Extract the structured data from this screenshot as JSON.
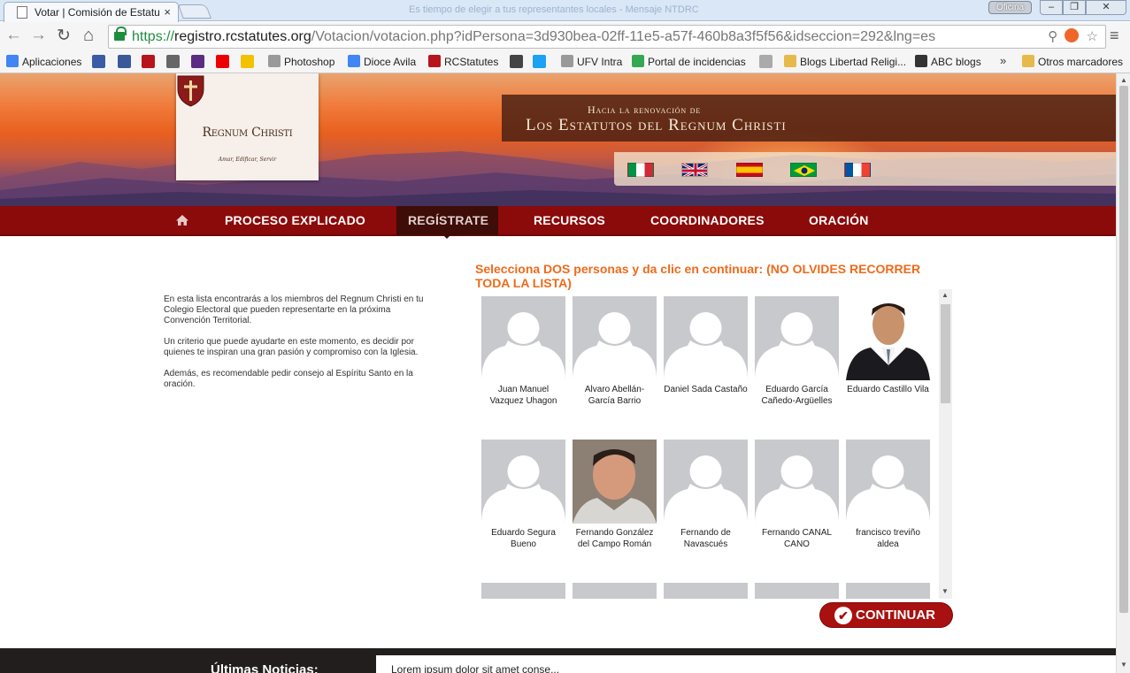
{
  "browser": {
    "tab_title": "Votar | Comisión de Estatu",
    "tab_close": "×",
    "window_title": "Es tiempo de elegir a tus representantes locales - Mensaje NTDRC",
    "profile": "Oficina",
    "window_controls": {
      "minimize": "‒",
      "maximize": "❐",
      "close": "✕"
    },
    "url_scheme": "https://",
    "url_host": "registro.rcstatutes.org",
    "url_path": "/Votacion/votacion.php?idPersona=3d930bea-02ff-11e5-a57f-460b8a3f5f56&idseccion=292&lng=es"
  },
  "bookmarks": {
    "items": [
      {
        "label": "Aplicaciones",
        "icon": "apps-grid-icon",
        "color": "#4285f4"
      },
      {
        "label": "",
        "icon": "bookmark-icon-1",
        "color": "#3b5ba5"
      },
      {
        "label": "",
        "icon": "facebook-icon",
        "color": "#3b5998"
      },
      {
        "label": "",
        "icon": "shield-icon",
        "color": "#b8141b"
      },
      {
        "label": "",
        "icon": "rc-icon",
        "color": "#666666"
      },
      {
        "label": "",
        "icon": "mail-icon",
        "color": "#5a2d82"
      },
      {
        "label": "",
        "icon": "santander-icon",
        "color": "#ec0000"
      },
      {
        "label": "",
        "icon": "b-icon",
        "color": "#f2c200"
      },
      {
        "label": "Photoshop",
        "icon": "page-icon",
        "color": "#999999"
      },
      {
        "label": "Dioce Avila",
        "icon": "google-icon",
        "color": "#4285f4"
      },
      {
        "label": "RCStatutes",
        "icon": "shield-icon",
        "color": "#b8141b"
      },
      {
        "label": "",
        "icon": "ao-icon",
        "color": "#444444"
      },
      {
        "label": "",
        "icon": "twitter-icon",
        "color": "#1da1f2"
      },
      {
        "label": "UFV Intra",
        "icon": "page-icon",
        "color": "#999999"
      },
      {
        "label": "Portal de incidencias",
        "icon": "chrome-icon",
        "color": "#34a853"
      },
      {
        "label": "",
        "icon": "cloud-icon",
        "color": "#aaaaaa"
      },
      {
        "label": "Blogs Libertad Religi...",
        "icon": "folder-icon",
        "color": "#e7b94a"
      },
      {
        "label": "ABC blogs",
        "icon": "abc-icon",
        "color": "#333333"
      }
    ],
    "more": "»",
    "other": "Otros marcadores"
  },
  "header": {
    "logo_title": "Regnum Christi",
    "logo_motto": "Amar, Edificar, Servir",
    "tagline_top": "Hacia la renovación de",
    "tagline_main": "Los Estatutos del Regnum Christi",
    "languages": [
      "Italiano",
      "English",
      "Español",
      "Português",
      "Français"
    ]
  },
  "nav": {
    "items": [
      "PROCESO EXPLICADO",
      "REGÍSTRATE",
      "RECURSOS",
      "COORDINADORES",
      "ORACIÓN"
    ],
    "active": "REGÍSTRATE"
  },
  "intro": [
    "En esta lista encontrarás a los miembros del Regnum Christi en tu Colegio Electoral que pueden representarte en la próxima Convención Territorial.",
    "Un criterio que puede ayudarte en este momento, es decidir por quienes te inspiran una gran pasión y compromiso con la Iglesia.",
    "Además, es recomendable pedir consejo al Espíritu Santo en la oración."
  ],
  "selection": {
    "heading": "Selecciona DOS personas y da clic en continuar: (NO OLVIDES RECORRER TODA LA LISTA)",
    "people": [
      {
        "name": "Juan Manuel Vazquez Uhagon",
        "photo": "placeholder"
      },
      {
        "name": "Alvaro Abellán-García Barrio",
        "photo": "placeholder"
      },
      {
        "name": "Daniel Sada Castaño",
        "photo": "placeholder"
      },
      {
        "name": "Eduardo García Cañedo-Argüelles",
        "photo": "placeholder"
      },
      {
        "name": "Eduardo Castillo Vila",
        "photo": "portrait-suit"
      },
      {
        "name": "Eduardo Segura Bueno",
        "photo": "placeholder"
      },
      {
        "name": "Fernando González del Campo Román",
        "photo": "portrait-casual"
      },
      {
        "name": "Fernando de Navascués",
        "photo": "placeholder"
      },
      {
        "name": "Fernando CANAL CANO",
        "photo": "placeholder"
      },
      {
        "name": "francisco treviño aldea",
        "photo": "placeholder"
      }
    ],
    "continue_label": "CONTINUAR"
  },
  "news": {
    "label": "Últimas Noticias:",
    "ticker": "Lorem ipsum dolor sit amet conse..."
  },
  "colors": {
    "accent_orange": "#ef6a1a",
    "nav_red": "#8b0a0a",
    "button_red": "#a8110f"
  }
}
